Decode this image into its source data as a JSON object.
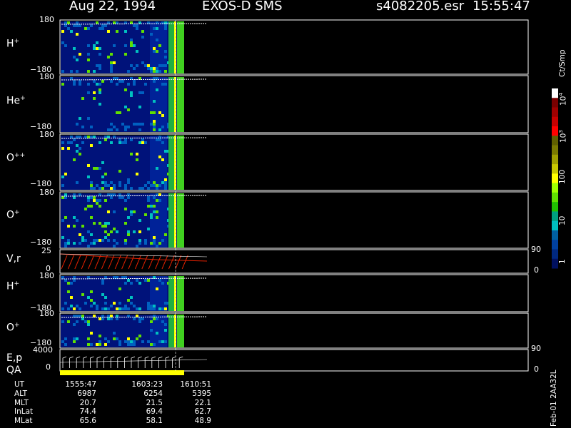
{
  "header": {
    "date": "Aug 22, 1994",
    "instrument": "EXOS-D SMS",
    "file": "s4082205.esr",
    "time": "15:55:47"
  },
  "panels": [
    {
      "label": "H",
      "sup": "+",
      "top_tick": "180",
      "bottom_tick": "−180"
    },
    {
      "label": "He",
      "sup": "+",
      "top_tick": "180",
      "bottom_tick": "−180"
    },
    {
      "label": "O",
      "sup": "++",
      "top_tick": "180",
      "bottom_tick": "−180"
    },
    {
      "label": "O",
      "sup": "+",
      "top_tick": "180",
      "bottom_tick": "−180"
    },
    {
      "label": "V,r",
      "sup": "",
      "top_tick": "25",
      "bottom_tick": "0",
      "right_top": "90",
      "right_bottom": "0"
    },
    {
      "label": "H",
      "sup": "+",
      "top_tick": "180",
      "bottom_tick": "−180"
    },
    {
      "label": "O",
      "sup": "+",
      "top_tick": "180",
      "bottom_tick": "−180"
    },
    {
      "label": "E,p",
      "sup": "",
      "top_tick": "4000",
      "bottom_tick": "0",
      "right_top": "90",
      "right_bottom": "0"
    },
    {
      "label": "QA",
      "sup": "",
      "top_tick": "",
      "bottom_tick": ""
    }
  ],
  "colorbar": {
    "unit": "Ct/Smp",
    "labels": [
      "10",
      "10",
      "100",
      "10",
      "1"
    ],
    "label_sups": [
      "4",
      "3",
      "",
      "",
      ""
    ],
    "colors": [
      "#ffffff",
      "#7a0000",
      "#a00000",
      "#c80000",
      "#ff0000",
      "#606000",
      "#7a7a00",
      "#a0a000",
      "#c8c800",
      "#ffff00",
      "#a0ff00",
      "#60e000",
      "#20c000",
      "#00a080",
      "#00c0c0",
      "#0060a0",
      "#0040a0",
      "#002880",
      "#001060"
    ]
  },
  "footer_table": {
    "rows": [
      {
        "label": "UT",
        "values": [
          "1555:47",
          "1603:23",
          "1610:51"
        ]
      },
      {
        "label": "ALT",
        "values": [
          "6987",
          "6254",
          "5395"
        ]
      },
      {
        "label": "MLT",
        "values": [
          "20.7",
          "21.5",
          "22.1"
        ]
      },
      {
        "label": "InLat",
        "values": [
          "74.4",
          "69.4",
          "62.7"
        ]
      },
      {
        "label": "MLat",
        "values": [
          "65.6",
          "58.1",
          "48.9"
        ]
      }
    ]
  },
  "side_note": "Feb-01 2AA32L",
  "chart_data": {
    "type": "heatmap",
    "title": "Aug 22, 1994   EXOS-D SMS",
    "x_ticks": [
      "1555:47",
      "1603:23",
      "1610:51"
    ],
    "panels": [
      "H+",
      "He+",
      "O++",
      "O+",
      "V,r",
      "H+",
      "O+",
      "E,p",
      "QA"
    ],
    "y_range_pitch_angle": [
      -180,
      180
    ],
    "colorbar_range": [
      1,
      10000
    ],
    "colorbar_scale": "log"
  }
}
